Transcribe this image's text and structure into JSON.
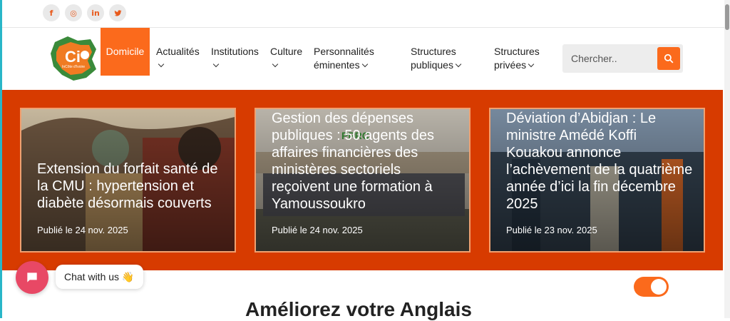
{
  "social": [
    {
      "name": "facebook-icon",
      "glyph": "f"
    },
    {
      "name": "instagram-icon",
      "glyph": "◎"
    },
    {
      "name": "linkedin-icon",
      "glyph": "in"
    },
    {
      "name": "twitter-icon",
      "glyph": "🐦"
    }
  ],
  "logo": {
    "caption": "InCôte d'Ivoire"
  },
  "nav": {
    "home": "Domicile",
    "actualites": "Actualités",
    "institutions": "Institutions",
    "culture": "Culture",
    "personnalites_1": "Personnalités",
    "personnalites_2": "éminentes",
    "structures_pub_1": "Structures",
    "structures_pub_2": "publiques",
    "structures_priv_1": "Structures",
    "structures_priv_2": "privées"
  },
  "search": {
    "placeholder": "Chercher.."
  },
  "cards": [
    {
      "title": "Extension du forfait santé de la CMU : hypertension et diabète désormais couverts",
      "date": "Publié le 24 nov. 2025"
    },
    {
      "title": "Gestion des dépenses publiques : 50 agents des affaires financières des ministères sectoriels reçoivent une formation à Yamoussoukro",
      "date": "Publié le 24 nov. 2025"
    },
    {
      "title": "Déviation d’Abidjan : Le ministre Amédé Koffi Kouakou annonce l’achèvement de la quatrième année d’ici la fin décembre 2025",
      "date": "Publié le 23 nov. 2025"
    }
  ],
  "chat": {
    "label": "Chat with us 👋"
  },
  "section": {
    "title": "Améliorez votre Anglais"
  },
  "colors": {
    "accent": "#fb6a1c",
    "hero_bg": "#d73b00",
    "chat": "#e84865"
  }
}
